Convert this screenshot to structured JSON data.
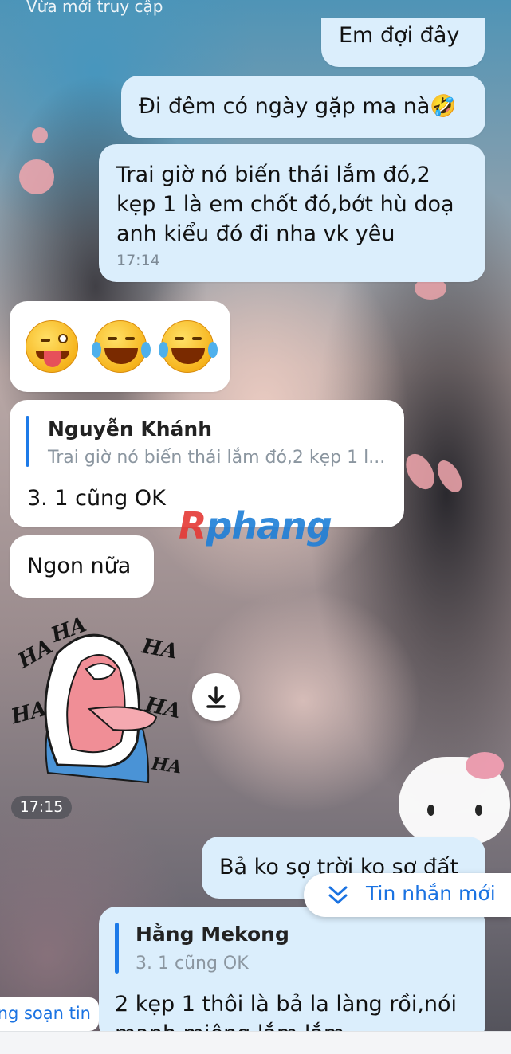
{
  "header": {
    "status_line": "Vừa mới truy cập"
  },
  "messages": {
    "wait": {
      "text": "Em đợi đây"
    },
    "ghost": {
      "text": "Đi đêm có ngày gặp ma nà🤣"
    },
    "trai": {
      "text": "Trai giờ nó biến thái lắm đó,2 kẹp 1 là em chốt đó,bớt hù doạ anh kiểu đó đi nha vk yêu",
      "time": "17:14"
    },
    "emoji": {
      "icons": [
        "winking-tongue-emoji",
        "tears-of-joy-emoji",
        "tears-of-joy-emoji"
      ]
    },
    "reply1": {
      "quote_name": "Nguyễn Khánh",
      "quote_snippet": "Trai giờ nó biến thái lắm đó,2 kẹp 1 l...",
      "text": "3. 1 cũng  OK"
    },
    "ngon": {
      "text": "Ngon nữa"
    },
    "sticker": {
      "words": [
        "HA",
        "HA",
        "HA",
        "HA",
        "HA",
        "HA"
      ],
      "time": "17:15"
    },
    "baco": {
      "text": "Bả ko sợ trời ko sợ đất"
    },
    "reply2": {
      "quote_name": "Hằng Mekong",
      "quote_snippet": "3. 1 cũng  OK",
      "text": "2 kẹp 1 thôi là bả la làng rồi,nói",
      "text2": "mạnh miệng lắm lắm"
    }
  },
  "new_messages_pill": {
    "label": "Tin nhắn mới",
    "icon": "double-chevron-down-icon"
  },
  "typing_indicator": {
    "text": "ng soạn tin"
  },
  "watermark": {
    "first": "R",
    "rest": "phang"
  },
  "colors": {
    "sent_bubble": "#dbeefc",
    "recv_bubble": "#ffffff",
    "accent": "#1b73e2",
    "quote_bar": "#1d7ae8"
  }
}
